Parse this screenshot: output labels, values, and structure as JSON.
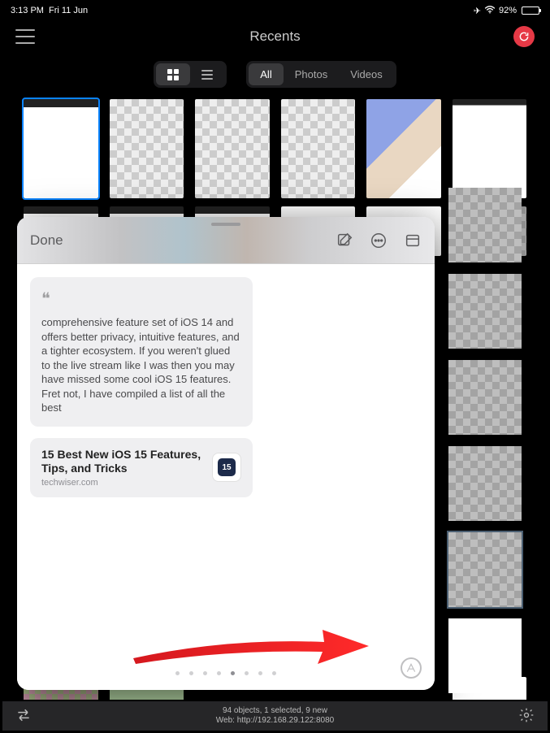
{
  "status": {
    "time": "3:13 PM",
    "date": "Fri 11 Jun",
    "battery_pct": "92%"
  },
  "nav": {
    "title": "Recents"
  },
  "filters": {
    "all": "All",
    "photos": "Photos",
    "videos": "Videos"
  },
  "popover": {
    "done": "Done",
    "note_text": "comprehensive feature set of iOS 14 and offers better privacy, intuitive features, and a tighter ecosystem. If you weren't glued to the live stream like I was then you may have missed some cool iOS 15 features. Fret not, I have compiled a list of all the best",
    "link_title": "15 Best New iOS 15 Features, Tips, and Tricks",
    "link_domain": "techwiser.com",
    "link_badge": "15",
    "page_count": 8,
    "page_active": 4
  },
  "footer": {
    "line1": "94 objects, 1 selected, 9 new",
    "line2": "Web: http://192.168.29.122:8080"
  }
}
